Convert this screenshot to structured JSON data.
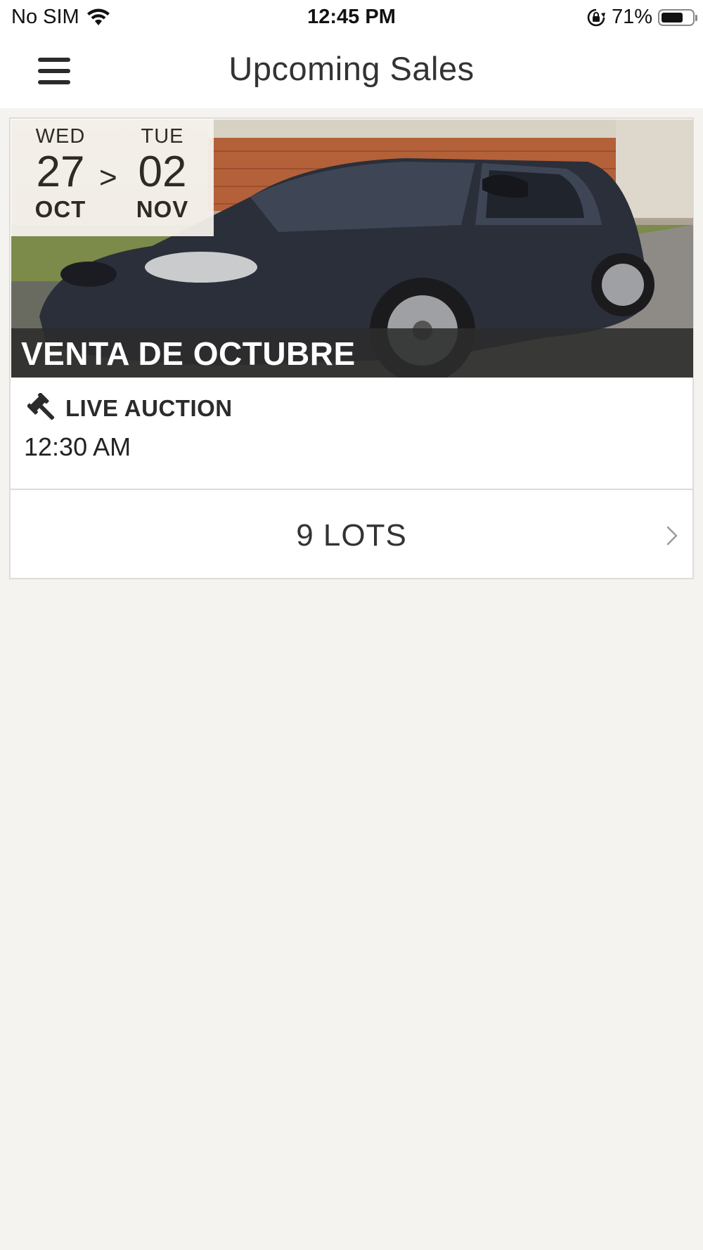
{
  "status_bar": {
    "carrier": "No SIM",
    "time": "12:45 PM",
    "battery_percent": "71%",
    "battery_level": 0.71,
    "icons": [
      "wifi-icon",
      "orientation-lock-icon",
      "battery-icon"
    ]
  },
  "nav": {
    "title": "Upcoming Sales",
    "menu_icon": "hamburger-menu-icon"
  },
  "sale": {
    "start": {
      "weekday": "WED",
      "day": "27",
      "month": "OCT"
    },
    "separator": ">",
    "end": {
      "weekday": "TUE",
      "day": "02",
      "month": "NOV"
    },
    "title": "VENTA DE OCTUBRE",
    "auction_type": "LIVE AUCTION",
    "auction_icon": "gavel-icon",
    "time": "12:30 AM",
    "lots_label": "9 LOTS",
    "lots_icon": "chevron-right-icon"
  },
  "colors": {
    "background": "#f4f3f0",
    "card": "#ffffff",
    "title_band": "#2c2c2c",
    "text": "#222222"
  }
}
